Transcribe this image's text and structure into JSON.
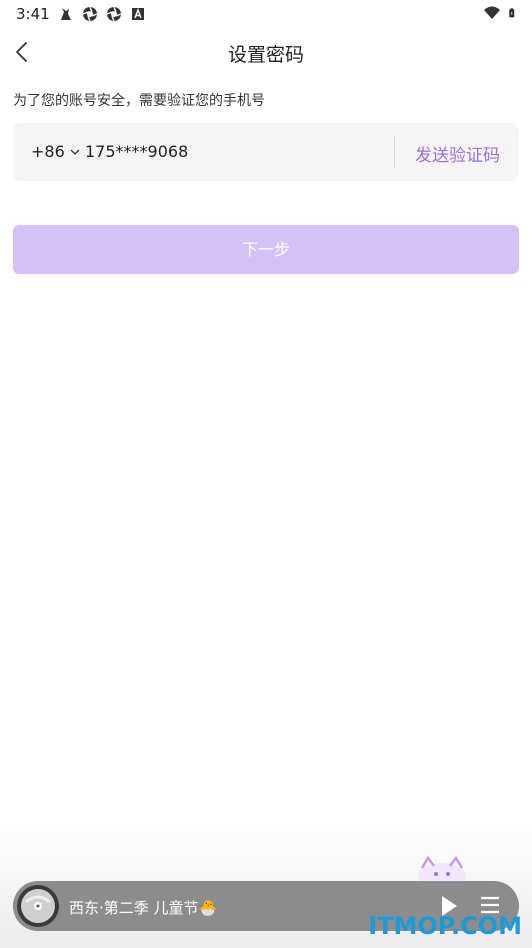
{
  "status_bar": {
    "time": "3:41",
    "left_icons": [
      "notification-pikachu-icon",
      "aperture-icon",
      "aperture-icon",
      "a-box-icon"
    ],
    "right_icons": [
      "wifi-icon",
      "battery-icon"
    ]
  },
  "header": {
    "title": "设置密码",
    "back_icon": "chevron-left-icon"
  },
  "form": {
    "prompt": "为了您的账号安全，需要验证您的手机号",
    "country_code": "+86",
    "phone_number": "175****9068",
    "send_code_label": "发送验证码",
    "next_label": "下一步"
  },
  "player": {
    "track_title": "西东·第二季 儿童节🐣",
    "disc_icon": "disc-icon",
    "play_icon": "play-icon",
    "playlist_icon": "playlist-icon"
  },
  "watermark": "ITMOP.COM",
  "colors": {
    "accent": "#9a70e0",
    "button_disabled": "#d4c2f6",
    "input_bg": "#f5f5f5",
    "player_bg": "#8c8c8c",
    "watermark": "#1a9bd7"
  }
}
